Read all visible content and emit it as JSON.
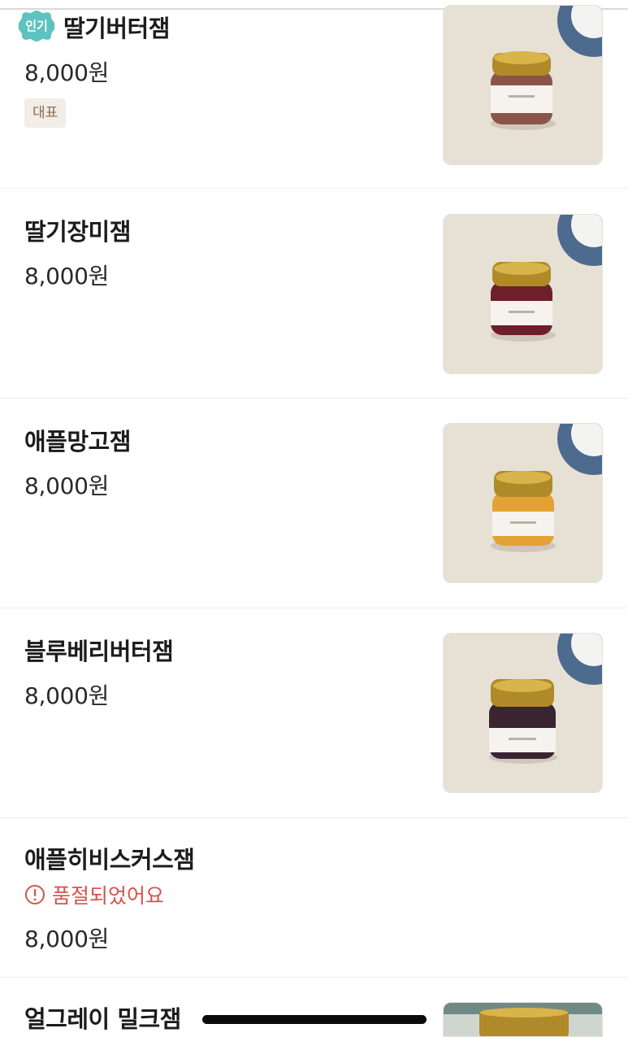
{
  "menu": {
    "items": [
      {
        "name": "딸기버터잼",
        "price": "8,000원",
        "badge": "인기",
        "tag": "대표",
        "jam_color": "#8a5548",
        "image": "strawberry-butter-jam-photo"
      },
      {
        "name": "딸기장미잼",
        "price": "8,000원",
        "jam_color": "#6e1f2c",
        "image": "strawberry-rose-jam-photo"
      },
      {
        "name": "애플망고잼",
        "price": "8,000원",
        "jam_color": "#e3a233",
        "image": "apple-mango-jam-photo"
      },
      {
        "name": "블루베리버터잼",
        "price": "8,000원",
        "jam_color": "#3a2432",
        "image": "blueberry-butter-jam-photo"
      },
      {
        "name": "애플히비스커스잼",
        "price": "8,000원",
        "status": "품절되었어요",
        "image": null
      },
      {
        "name": "얼그레이 밀크잼",
        "price": "",
        "image": "earl-grey-milk-jam-photo"
      }
    ]
  },
  "colors": {
    "badge_bg": "#5cc3c0",
    "tag_bg": "#f2ede6",
    "tag_text": "#8b6d55",
    "sold_out": "#d6534a",
    "divider": "#eeeeee"
  },
  "icons": {
    "sold_out": "alert-circle-icon",
    "badge": "scalloped-badge"
  }
}
